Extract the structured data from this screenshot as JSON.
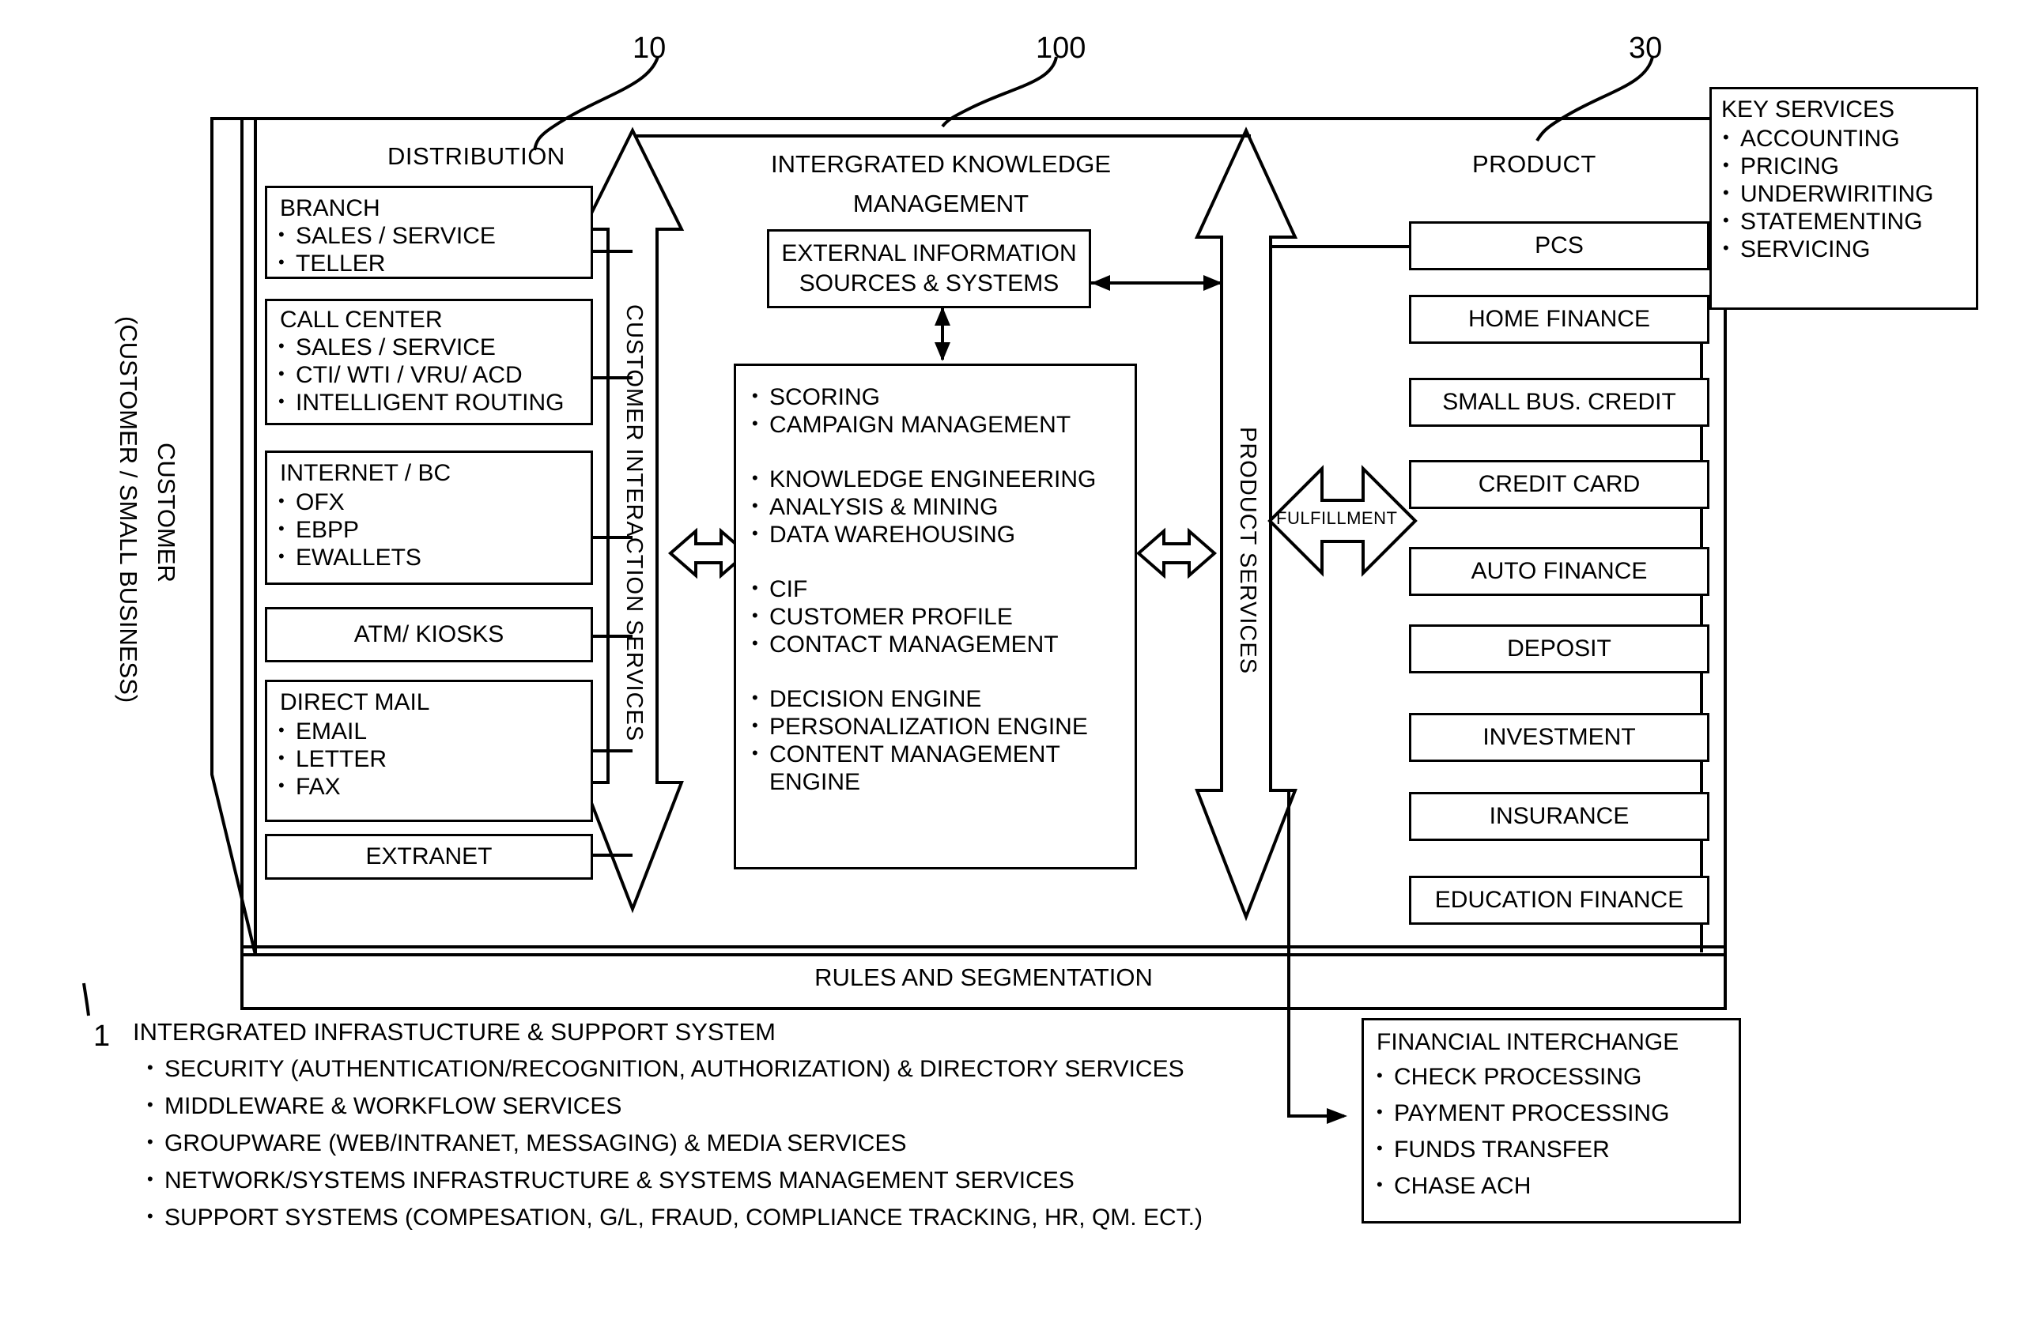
{
  "figure": {
    "refs": [
      {
        "id": "10",
        "label": "10"
      },
      {
        "id": "100",
        "label": "100"
      },
      {
        "id": "30",
        "label": "30"
      },
      {
        "id": "1",
        "label": "1"
      }
    ]
  },
  "customer": {
    "line1": "CUSTOMER",
    "line2": "(CUSTOMER / SMALL BUSINESS)"
  },
  "distribution": {
    "title": "DISTRIBUTION",
    "channels": [
      {
        "header": "BRANCH",
        "items": [
          "SALES / SERVICE",
          "TELLER"
        ]
      },
      {
        "header": "CALL CENTER",
        "items": [
          "SALES / SERVICE",
          "CTI/ WTI / VRU/ ACD",
          "INTELLIGENT ROUTING"
        ]
      },
      {
        "header": "INTERNET / BC",
        "items": [
          "OFX",
          "EBPP",
          "EWALLETS"
        ]
      },
      {
        "header": "ATM/ KIOSKS",
        "items": []
      },
      {
        "header": "DIRECT MAIL",
        "items": [
          "EMAIL",
          "LETTER",
          "FAX"
        ]
      },
      {
        "header": "EXTRANET",
        "items": []
      }
    ]
  },
  "customer_interaction_arrow": {
    "label": "CUSTOMER INTERACTION SERVICES"
  },
  "ikm": {
    "title_line1": "INTERGRATED KNOWLEDGE",
    "title_line2": "MANAGEMENT",
    "external": {
      "line1": "EXTERNAL INFORMATION",
      "line2": "SOURCES & SYSTEMS"
    },
    "groups": [
      [
        "SCORING",
        "CAMPAIGN MANAGEMENT"
      ],
      [
        "KNOWLEDGE ENGINEERING",
        "ANALYSIS & MINING",
        "DATA WAREHOUSING"
      ],
      [
        "CIF",
        "CUSTOMER PROFILE",
        "CONTACT MANAGEMENT"
      ],
      [
        "DECISION ENGINE",
        "PERSONALIZATION ENGINE",
        "CONTENT MANAGEMENT"
      ]
    ],
    "wrap_tail": "ENGINE"
  },
  "product_services_arrow": {
    "label": "PRODUCT SERVICES"
  },
  "fulfillment_arrow": {
    "label": "FULFILLMENT"
  },
  "product": {
    "title": "PRODUCT",
    "items": [
      "PCS",
      "HOME  FINANCE",
      "SMALL BUS. CREDIT",
      "CREDIT CARD",
      "AUTO FINANCE",
      "DEPOSIT",
      "INVESTMENT",
      "INSURANCE",
      "EDUCATION FINANCE"
    ]
  },
  "key_services": {
    "title": "KEY SERVICES",
    "items": [
      "ACCOUNTING",
      "PRICING",
      "UNDERWIRITING",
      "STATEMENTING",
      "SERVICING"
    ]
  },
  "rules_band": {
    "label": "RULES AND SEGMENTATION"
  },
  "infrastructure": {
    "title": "INTERGRATED INFRASTUCTURE & SUPPORT SYSTEM",
    "items": [
      "SECURITY (AUTHENTICATION/RECOGNITION, AUTHORIZATION) & DIRECTORY SERVICES",
      "MIDDLEWARE & WORKFLOW SERVICES",
      "GROUPWARE (WEB/INTRANET, MESSAGING) & MEDIA SERVICES",
      "NETWORK/SYSTEMS INFRASTRUCTURE & SYSTEMS MANAGEMENT SERVICES",
      "SUPPORT SYSTEMS (COMPESATION, G/L, FRAUD, COMPLIANCE TRACKING, HR, QM. ECT.)"
    ]
  },
  "financial_interchange": {
    "title": "FINANCIAL INTERCHANGE",
    "items": [
      "CHECK PROCESSING",
      "PAYMENT PROCESSING",
      "FUNDS TRANSFER",
      "CHASE ACH"
    ]
  }
}
